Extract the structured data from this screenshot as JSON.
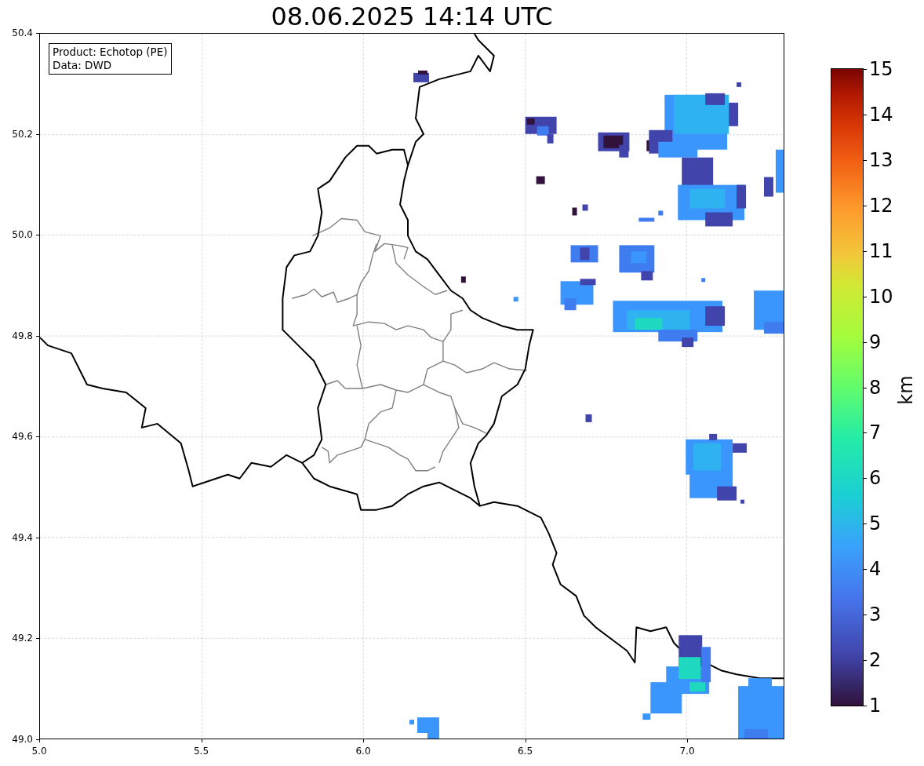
{
  "title": "08.06.2025 14:14 UTC",
  "map": {
    "info_box": [
      "Product: Echotop (PE)",
      "Data: DWD"
    ],
    "x_ticks": [
      "5.0",
      "5.5",
      "6.0",
      "6.5",
      "7.0"
    ],
    "y_ticks": [
      "50.4",
      "50.2",
      "50.0",
      "49.8",
      "49.6",
      "49.4",
      "49.2",
      "49.0"
    ]
  },
  "colorbar": {
    "label": "km",
    "ticks": [
      "15",
      "14",
      "13",
      "12",
      "11",
      "10",
      "9",
      "8",
      "7",
      "6",
      "5",
      "4",
      "3",
      "2",
      "1"
    ]
  }
}
